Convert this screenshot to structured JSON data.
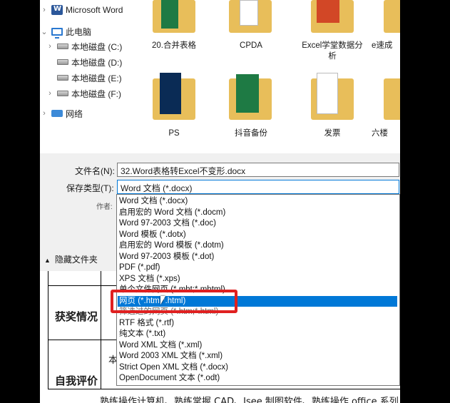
{
  "nav": {
    "items": [
      {
        "label": "Microsoft Word",
        "icon": "word-icon",
        "chevron": "›"
      },
      {
        "label": "此电脑",
        "icon": "computer-icon",
        "chevron": "⌄"
      },
      {
        "label": "本地磁盘 (C:)",
        "icon": "disk-icon",
        "chevron": "›"
      },
      {
        "label": "本地磁盘 (D:)",
        "icon": "disk-icon",
        "chevron": ""
      },
      {
        "label": "本地磁盘 (E:)",
        "icon": "disk-icon",
        "chevron": ""
      },
      {
        "label": "本地磁盘 (F:)",
        "icon": "disk-icon",
        "chevron": "›"
      },
      {
        "label": "网络",
        "icon": "network-icon",
        "chevron": "›"
      }
    ]
  },
  "files": [
    {
      "label": "20.合并表格"
    },
    {
      "label": "CPDA"
    },
    {
      "label": "Excel学堂数据分析"
    },
    {
      "label": "e速成"
    },
    {
      "label": "PS"
    },
    {
      "label": "抖音备份"
    },
    {
      "label": "发票"
    },
    {
      "label": "六楼"
    }
  ],
  "form": {
    "filename_label": "文件名(N):",
    "filename_value": "32.Word表格转Excel不变形.docx",
    "savetype_label": "保存类型(T):",
    "savetype_value": "Word 文档 (*.docx)",
    "author_label": "作者:",
    "hide_folders_label": "隐藏文件夹"
  },
  "dropdown": {
    "options": [
      "Word 文档 (*.docx)",
      "启用宏的 Word 文档 (*.docm)",
      "Word 97-2003 文档 (*.doc)",
      "Word 模板 (*.dotx)",
      "启用宏的 Word 模板 (*.dotm)",
      "Word 97-2003 模板 (*.dot)",
      "PDF (*.pdf)",
      "XPS 文档 (*.xps)",
      "单个文件网页 (*.mht;*.mhtml)",
      "网页 (*.htm;*.html)",
      "筛选过的网页 (*.htm;*.html)",
      "RTF 格式 (*.rtf)",
      "纯文本 (*.txt)",
      "Word XML 文档 (*.xml)",
      "Word 2003 XML 文档 (*.xml)",
      "Strict Open XML 文档 (*.docx)",
      "OpenDocument 文本 (*.odt)"
    ],
    "selected_index": 9
  },
  "document": {
    "section1": "获奖情况",
    "section2": "自我评价",
    "partial_char": "本",
    "body_line": "熟练操作计算机、熟练掌握 CAD、Isee 制图软件、熟练操作 office 系列"
  }
}
